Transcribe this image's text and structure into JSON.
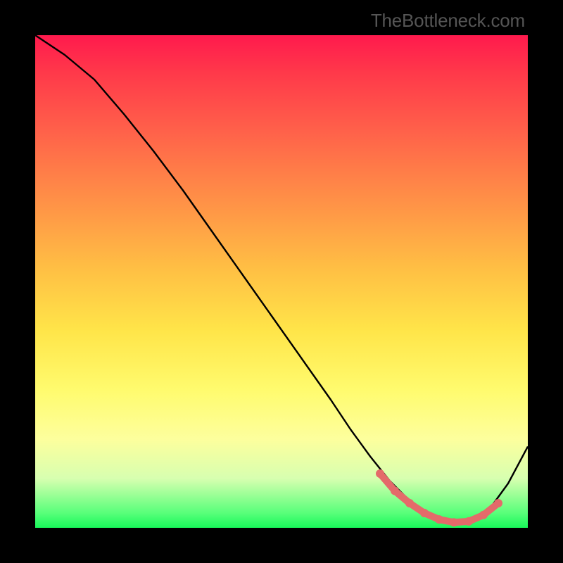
{
  "watermark": "TheBottleneck.com",
  "chart_data": {
    "type": "line",
    "title": "",
    "xlabel": "",
    "ylabel": "",
    "xlim": [
      0,
      100
    ],
    "ylim": [
      0,
      100
    ],
    "note": "Axes are unlabeled; x is normalized 0–100 left→right, y is normalized 0–100 with 0 at the bottom. Values below are estimated from the rendered curve and highlight segment.",
    "series": [
      {
        "name": "curve",
        "x": [
          0,
          6,
          12,
          18,
          24,
          30,
          36,
          42,
          48,
          54,
          60,
          64,
          68,
          72,
          76,
          80,
          84,
          88,
          92,
          96,
          100
        ],
        "values": [
          100,
          96,
          91,
          84,
          76.5,
          68.5,
          60,
          51.5,
          43,
          34.5,
          26,
          20,
          14.5,
          9.5,
          5.5,
          2.5,
          1,
          1,
          3.5,
          9,
          16.5
        ]
      },
      {
        "name": "highlight",
        "color": "#e46a6a",
        "x": [
          70,
          73,
          76,
          79,
          82,
          85,
          88,
          91,
          94
        ],
        "values": [
          11,
          7.5,
          5,
          3,
          1.7,
          1.1,
          1.3,
          2.6,
          5
        ]
      }
    ],
    "background_gradient": {
      "orientation": "vertical",
      "stops": [
        {
          "pos": 0.0,
          "color": "#ff1a4d"
        },
        {
          "pos": 0.3,
          "color": "#ff8046"
        },
        {
          "pos": 0.6,
          "color": "#ffe549"
        },
        {
          "pos": 0.85,
          "color": "#f6ffa0"
        },
        {
          "pos": 1.0,
          "color": "#18f85a"
        }
      ]
    }
  }
}
